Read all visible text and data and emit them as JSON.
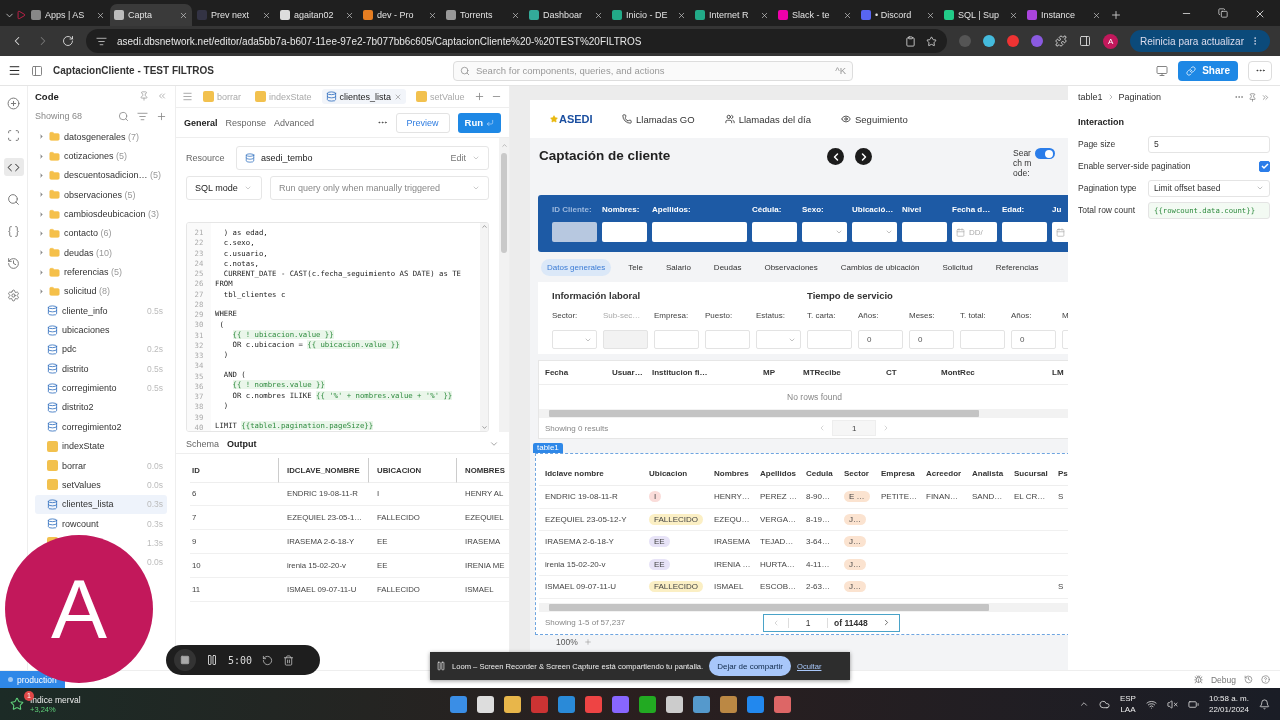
{
  "browser": {
    "tabs": [
      {
        "title": "Apps | AS",
        "selected": false
      },
      {
        "title": "Capta",
        "selected": true
      },
      {
        "title": "Prev next",
        "selected": false
      },
      {
        "title": "agaitan02",
        "selected": false
      },
      {
        "title": "dev - Pro",
        "selected": false
      },
      {
        "title": "Torrents",
        "selected": false
      },
      {
        "title": "Dashboar",
        "selected": false
      },
      {
        "title": "Inicio - DE",
        "selected": false
      },
      {
        "title": "Internet R",
        "selected": false
      },
      {
        "title": "Slack - te",
        "selected": false
      },
      {
        "title": "• Discord",
        "selected": false
      },
      {
        "title": "SQL | Sup",
        "selected": false
      },
      {
        "title": "Instance",
        "selected": false
      }
    ],
    "url": "asedi.dbsnetwork.net/editor/ada5bb7a-b607-11ee-97e2-7b077bb6c605/CaptacionCliente%20-%20TEST%20FILTROS",
    "profile": "A",
    "update_button": "Reinicia para actualizar"
  },
  "app_header": {
    "title": "CaptacionCliente - TEST FILTROS",
    "search": {
      "placeholder": "Search for components, queries, and actions",
      "shortcut": "^K"
    },
    "share": "Share"
  },
  "code_sidebar": {
    "title": "Code",
    "count": "Showing 68",
    "items": [
      {
        "kind": "folder",
        "name": "datosgenerales",
        "count": "(7)",
        "selected": false
      },
      {
        "kind": "folder",
        "name": "cotizaciones",
        "count": "(5)",
        "selected": false
      },
      {
        "kind": "folder",
        "name": "descuentosadicion…",
        "count": "(5)",
        "selected": false
      },
      {
        "kind": "folder",
        "name": "observaciones",
        "count": "(5)",
        "selected": false
      },
      {
        "kind": "folder",
        "name": "cambiosdeubicacion",
        "count": "(3)",
        "selected": false
      },
      {
        "kind": "folder",
        "name": "contacto",
        "count": "(6)",
        "selected": false
      },
      {
        "kind": "folder",
        "name": "deudas",
        "count": "(10)",
        "selected": false
      },
      {
        "kind": "folder",
        "name": "referencias",
        "count": "(5)",
        "selected": false
      },
      {
        "kind": "folder",
        "name": "solicitud",
        "count": "(8)",
        "selected": false
      },
      {
        "kind": "query",
        "name": "cliente_info",
        "time": "0.5s",
        "selected": false
      },
      {
        "kind": "query",
        "name": "ubicaciones",
        "selected": false
      },
      {
        "kind": "query",
        "name": "pdc",
        "time": "0.2s",
        "selected": false
      },
      {
        "kind": "query",
        "name": "distrito",
        "time": "0.5s",
        "selected": false
      },
      {
        "kind": "query",
        "name": "corregimiento",
        "time": "0.5s",
        "selected": false
      },
      {
        "kind": "query",
        "name": "distrito2",
        "selected": false
      },
      {
        "kind": "query",
        "name": "corregimiento2",
        "selected": false
      },
      {
        "kind": "variable",
        "name": "indexState",
        "selected": false
      },
      {
        "kind": "js",
        "name": "borrar",
        "time": "0.0s",
        "selected": false
      },
      {
        "kind": "js",
        "name": "setValues",
        "time": "0.0s",
        "selected": false
      },
      {
        "kind": "query",
        "name": "clientes_lista",
        "time": "0.3s",
        "selected": true
      },
      {
        "kind": "query",
        "name": "rowcount",
        "time": "0.3s",
        "selected": false
      },
      {
        "kind": "js",
        "time": "1.3s",
        "selected": false
      },
      {
        "time": "0.0s",
        "selected": false
      }
    ]
  },
  "query_editor": {
    "tabs": [
      {
        "kind": "js",
        "label": "borrar",
        "selected": false
      },
      {
        "kind": "variable",
        "label": "indexState",
        "selected": false
      },
      {
        "kind": "query",
        "label": "clientes_lista",
        "selected": true
      },
      {
        "kind": "js",
        "label": "setValue",
        "selected": false
      }
    ],
    "subtabs": [
      {
        "label": "General",
        "selected": true
      },
      {
        "label": "Response",
        "selected": false
      },
      {
        "label": "Advanced",
        "selected": false
      }
    ],
    "preview": "Preview",
    "run": "Run",
    "resource_label": "Resource",
    "resource": "asedi_tembo",
    "edit": "Edit",
    "mode": "SQL mode",
    "trigger": "Run query only when manually triggered",
    "code": [
      {
        "n": "21",
        "text": "  ) as edad,"
      },
      {
        "n": "22",
        "text": "  c.sexo,"
      },
      {
        "n": "23",
        "text": "  c.usuario,"
      },
      {
        "n": "24",
        "text": "  c.notas,"
      },
      {
        "n": "25",
        "text": "  CURRENT_DATE - CAST(c.fecha_seguimiento AS DATE) as TE"
      },
      {
        "n": "26",
        "text": "FROM"
      },
      {
        "n": "27",
        "text": "  tbl_clientes c"
      },
      {
        "n": "28"
      },
      {
        "n": "29",
        "text": "WHERE"
      },
      {
        "n": "30",
        "text": " ("
      },
      {
        "n": "31",
        "tpl": "    {{ ! ubicacion.value }}"
      },
      {
        "n": "32",
        "text": "    OR c.ubicacion = ",
        "tpl": "{{ ubicacion.value }}"
      },
      {
        "n": "33",
        "text": "  )"
      },
      {
        "n": "34"
      },
      {
        "n": "35",
        "text": "  AND ("
      },
      {
        "n": "36",
        "tpl": "    {{ ! nombres.value }}"
      },
      {
        "n": "37",
        "text": "    OR c.nombres ILIKE ",
        "tpl": "{{ '%' + nombres.value + '%' }}"
      },
      {
        "n": "38",
        "text": "  )"
      },
      {
        "n": "39"
      },
      {
        "n": "40",
        "text": "LIMIT ",
        "tpl": "{{table1.pagination.pageSize}}"
      }
    ],
    "result_tabs": [
      {
        "label": "Schema",
        "selected": false
      },
      {
        "label": "Output",
        "selected": true
      }
    ],
    "output": {
      "columns": [
        "ID",
        "IDCLAVE_NOMBRE",
        "UBICACION",
        "NOMBRES"
      ],
      "rows": [
        [
          "6",
          "ENDRIC 19-08-11-R",
          "I",
          "HENRY AL"
        ],
        [
          "7",
          "EZEQUIEL 23-05-1…",
          "FALLECIDO",
          "EZEQUIEL"
        ],
        [
          "9",
          "IRASEMA 2-6-18-Y",
          "EE",
          "IRASEMA"
        ],
        [
          "10",
          "irenia 15-02-20-v",
          "EE",
          "IRENIA ME"
        ],
        [
          "11",
          "ISMAEL 09-07-11-U",
          "FALLECIDO",
          "ISMAEL"
        ]
      ]
    }
  },
  "canvas": {
    "logo": "ASEDI",
    "nav": [
      {
        "kind": "phone",
        "label": "Llamadas GO"
      },
      {
        "kind": "users",
        "label": "Llamadas del día"
      },
      {
        "kind": "eye",
        "label": "Seguimiento"
      }
    ],
    "title": "Captación de cliente",
    "search_mode": {
      "label": "Search mode:",
      "on": true
    },
    "filters": [
      {
        "label": "ID Cliente:",
        "kind": "disabled"
      },
      {
        "label": "Nombres:",
        "kind": "input"
      },
      {
        "label": "Apellidos:",
        "kind": "wide"
      },
      {
        "label": "Cédula:",
        "kind": "input"
      },
      {
        "label": "Sexo:",
        "kind": "select"
      },
      {
        "label": "Ubicació…",
        "kind": "select"
      },
      {
        "label": "Nivel",
        "kind": "input"
      },
      {
        "label": "Fecha d…",
        "kind": "date",
        "placeholder": "DD/"
      },
      {
        "label": "Edad:",
        "kind": "input"
      },
      {
        "label": "Ju",
        "kind": "date"
      }
    ],
    "tabs": [
      {
        "label": "Datos generales",
        "selected": true
      },
      {
        "label": "Tele",
        "selected": false
      },
      {
        "label": "Salario",
        "selected": false
      },
      {
        "label": "Deudas",
        "selected": false
      },
      {
        "label": "Observaciones",
        "selected": false
      },
      {
        "label": "Cambios de ubicación",
        "selected": false
      },
      {
        "label": "Solicitud",
        "selected": false
      },
      {
        "label": "Referencias",
        "selected": false
      }
    ],
    "sections": [
      "Información laboral",
      "Tiempo de servicio"
    ],
    "fields": [
      {
        "label": "Sector:",
        "kind": "select"
      },
      {
        "label": "Sub-sec…",
        "kind": "disabled"
      },
      {
        "label": "Empresa:",
        "kind": "input"
      },
      {
        "label": "Puesto:",
        "kind": "input"
      },
      {
        "label": "Estatus:",
        "kind": "select"
      },
      {
        "label": "T. carta:",
        "kind": "input"
      },
      {
        "label": "Años:",
        "kind": "input",
        "value": "0"
      },
      {
        "label": "Meses:",
        "kind": "input",
        "value": "0"
      },
      {
        "label": "T. total:",
        "kind": "input"
      },
      {
        "label": "Años:",
        "kind": "input",
        "value": "0"
      },
      {
        "label": "M",
        "kind": "input"
      }
    ],
    "salary_table": {
      "columns": [
        "Fecha",
        "Usuar…",
        "Institucion fi…",
        "MP",
        "MTRecibe",
        "CT",
        "MontRec",
        "LM"
      ],
      "empty": "No rows found",
      "footer": "Showing 0 results",
      "page": "1"
    },
    "table1": {
      "badge": "table1",
      "columns": [
        "Idclave nombre",
        "Ubicacion",
        "Nombres",
        "Apellidos",
        "Cedula",
        "Sector",
        "Empresa",
        "Acreedor",
        "Analista",
        "Sucursal",
        "Ps"
      ],
      "rows": [
        [
          "ENDRIC 19-08-11-R",
          {
            "text": "I",
            "color": "#fadcd9"
          },
          "HENRY…",
          "PEREZ …",
          "8-90…",
          {
            "text": "E …",
            "color": "#fbe3d0"
          },
          "PETITE…",
          "FINAN…",
          "SAND…",
          "EL CR…",
          "S"
        ],
        [
          "EZEQUIEL 23-05-12-Y",
          {
            "text": "FALLECIDO",
            "color": "#fbefc4"
          },
          "EZEQU…",
          "VERGA…",
          "8-19…",
          {
            "text": "J…",
            "color": "#fbe3d0"
          }
        ],
        [
          "IRASEMA 2-6-18-Y",
          {
            "text": "EE",
            "color": "#e7e3f7"
          },
          "IRASEMA",
          "TEJAD…",
          "3-64…",
          {
            "text": "J…",
            "color": "#fbe3d0"
          }
        ],
        [
          "irenia 15-02-20-v",
          {
            "text": "EE",
            "color": "#e7e3f7"
          },
          "IRENIA …",
          "HURTA…",
          "4-11…",
          {
            "text": "J…",
            "color": "#fbe3d0"
          }
        ],
        [
          "ISMAEL 09-07-11-U",
          {
            "text": "FALLECIDO",
            "color": "#fbefc4"
          },
          "ISMAEL",
          "ESCOB…",
          "2-63…",
          {
            "text": "J…",
            "color": "#fbe3d0"
          },
          null,
          null,
          null,
          null,
          "S"
        ]
      ],
      "footer": "Showing 1-5 of 57,237",
      "page": "1",
      "page_total": "of 11448"
    },
    "zoom": "100%"
  },
  "inspector": {
    "breadcrumb": [
      "table1",
      "Pagination"
    ],
    "section": "Interaction",
    "page_size_label": "Page size",
    "page_size": "5",
    "server_side_label": "Enable server-side pagination",
    "server_side": true,
    "type_label": "Pagination type",
    "type": "Limit offset based",
    "total_label": "Total row count",
    "total": "{{rowcount.data.count}}"
  },
  "status_bar": {
    "environment": "production",
    "debug": "Debug"
  },
  "overlays": {
    "avatar": "A",
    "recorder_time": "5:00",
    "banner": {
      "message": "Loom – Screen Recorder & Screen Capture está compartiendo tu pantalla.",
      "stop": "Dejar de compartir",
      "hide": "Ocultar"
    }
  },
  "taskbar": {
    "widget": {
      "title": "Índice merval",
      "value": "+3,24%",
      "badge": "1"
    },
    "language": [
      "ESP",
      "LAA"
    ],
    "time": "10:58 a. m.",
    "date": "22/01/2024"
  }
}
